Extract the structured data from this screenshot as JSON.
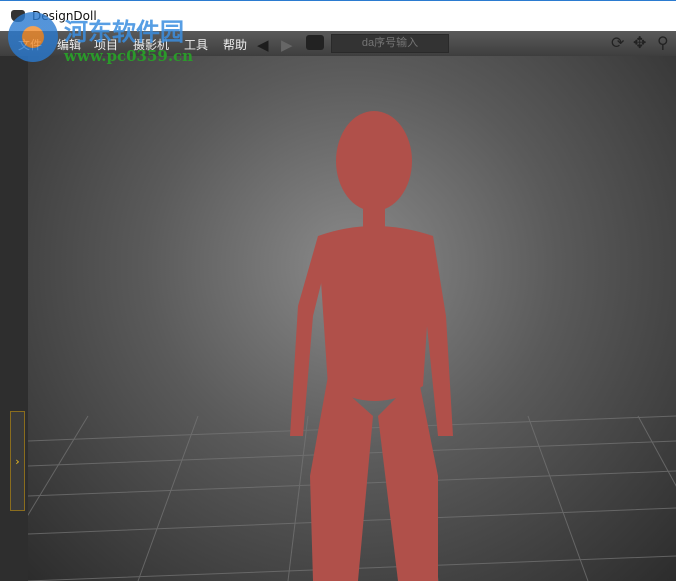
{
  "window": {
    "title": "DesignDoll"
  },
  "menu": [
    "文件",
    "编辑",
    "项目",
    "摄影机",
    "工具",
    "帮助"
  ],
  "toolbar": {
    "serial_placeholder": "da序号输入"
  },
  "watermark": {
    "name": "河东软件园",
    "url": "www.pc0359.cn"
  }
}
